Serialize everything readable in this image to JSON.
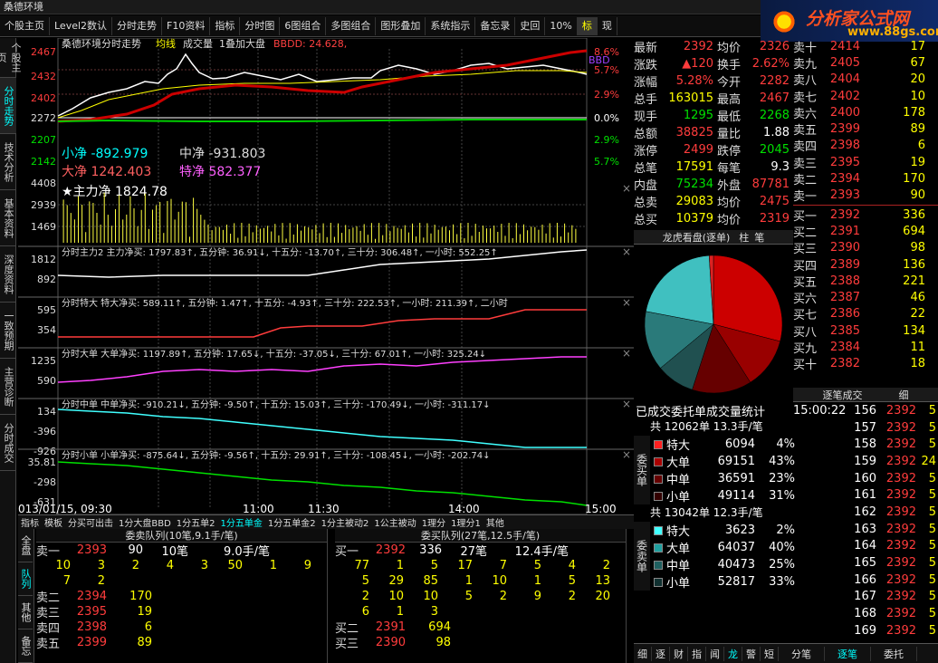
{
  "window": {
    "title": "桑德环境"
  },
  "toolbar": [
    "个股主页",
    "Level2数认",
    "分时走势",
    "F10资料",
    "指标",
    "分时图",
    "6图组合",
    "多图组合",
    "图形叠加",
    "系统指示",
    "备忘录",
    "史回",
    "10%",
    "标",
    "现"
  ],
  "logo": {
    "line1": "分析家公式网",
    "line2": "www.88gs.com"
  },
  "leftnav": [
    "个股主页",
    "分时走势",
    "技术分析",
    "基本资料",
    "深度资料",
    "一致预期",
    "主营诊断",
    "分时成交"
  ],
  "chart": {
    "header": {
      "name": "桑德环境分时走势",
      "avg": "均线",
      "vol": "成交量",
      "overlay": "1叠加大盘",
      "bbdd": "BBDD: 24.628,"
    },
    "price_labels": [
      "2467",
      "2432",
      "2402",
      "2272",
      "2207",
      "2142",
      "4408",
      "2939",
      "1469"
    ],
    "pct_labels": [
      "8.6%",
      "5.7%",
      "2.9%",
      "0.0%",
      "2.9%",
      "5.7%"
    ],
    "bbd_tag": "BBD",
    "net": {
      "small_label": "小净",
      "small": "-892.979",
      "mid_label": "中净",
      "mid": "-931.803",
      "big_label": "大净",
      "big": "1242.403",
      "super_label": "特净",
      "super": "582.377",
      "main_label": "★主力净",
      "main": "1824.78"
    },
    "sub": [
      {
        "labels": [
          "1812",
          "892"
        ],
        "hdr": "分时主力2 主力净买: 1797.83↑, 五分钟: 36.91↓, 十五分: -13.70↑, 三十分: 306.48↑, 一小时: 552.25↑"
      },
      {
        "labels": [
          "595",
          "354"
        ],
        "hdr": "分时特大 特大净买: 589.11↑, 五分钟: 1.47↑, 十五分: -4.93↑, 三十分: 222.53↑, 一小时: 211.39↑, 二小时"
      },
      {
        "labels": [
          "1235",
          "590"
        ],
        "hdr": "分时大单 大单净买: 1197.89↑, 五分钟: 17.65↓, 十五分: -37.05↓, 三十分: 67.01↑, 一小时: 325.24↓"
      },
      {
        "labels": [
          "134",
          "-396",
          "-926"
        ],
        "hdr": "分时中单 中单净买: -910.21↓, 五分钟: -9.50↑, 十五分: 15.03↑, 三十分: -170.49↓, 一小时: -311.17↓"
      },
      {
        "labels": [
          "35.81",
          "-298",
          "-631"
        ],
        "hdr": "分时小单 小单净买: -875.64↓, 五分钟: -9.56↑, 十五分: 29.91↑, 三十分: -108.45↓, 一小时: -202.74↓"
      }
    ],
    "xaxis": [
      "013/01/15, 09:30",
      "11:00",
      "11:30",
      "14:00",
      "15:00"
    ]
  },
  "quote": [
    [
      "最新",
      "2392",
      "均价",
      "2326"
    ],
    [
      "涨跌",
      "▲120",
      "换手",
      "2.62%"
    ],
    [
      "涨幅",
      "5.28%",
      "今开",
      "2282"
    ],
    [
      "总手",
      "163015",
      "最高",
      "2467"
    ],
    [
      "现手",
      "1295",
      "最低",
      "2268"
    ],
    [
      "总额",
      "38825",
      "量比",
      "1.88"
    ],
    [
      "涨停",
      "2499",
      "跌停",
      "2045"
    ],
    [
      "总笔",
      "17591",
      "每笔",
      "9.3"
    ],
    [
      "内盘",
      "75234",
      "外盘",
      "87781"
    ],
    [
      "总卖",
      "29083",
      "均价",
      "2475"
    ],
    [
      "总买",
      "10379",
      "均价",
      "2319"
    ]
  ],
  "pankou": {
    "sell": [
      [
        "卖十",
        "2414",
        "17"
      ],
      [
        "卖九",
        "2405",
        "67"
      ],
      [
        "卖八",
        "2404",
        "20"
      ],
      [
        "卖七",
        "2402",
        "10"
      ],
      [
        "卖六",
        "2400",
        "178"
      ],
      [
        "卖五",
        "2399",
        "89"
      ],
      [
        "卖四",
        "2398",
        "6"
      ],
      [
        "卖三",
        "2395",
        "19"
      ],
      [
        "卖二",
        "2394",
        "170"
      ],
      [
        "卖一",
        "2393",
        "90"
      ]
    ],
    "buy": [
      [
        "买一",
        "2392",
        "336"
      ],
      [
        "买二",
        "2391",
        "694"
      ],
      [
        "买三",
        "2390",
        "98"
      ],
      [
        "买四",
        "2389",
        "136"
      ],
      [
        "买五",
        "2388",
        "221"
      ],
      [
        "买六",
        "2387",
        "46"
      ],
      [
        "买七",
        "2386",
        "22"
      ],
      [
        "买八",
        "2385",
        "134"
      ],
      [
        "买九",
        "2384",
        "11"
      ],
      [
        "买十",
        "2382",
        "18"
      ]
    ]
  },
  "pie": {
    "title": "龙虎看盘(逐单)",
    "tabs": [
      "柱",
      "笔"
    ],
    "colors": [
      "#cc0000",
      "#990000",
      "#660000",
      "#205050",
      "#2a7a7a",
      "#40c0c0",
      "#dd2222"
    ],
    "values": [
      29,
      12,
      14,
      9,
      14,
      21,
      1
    ]
  },
  "stats": {
    "title": "已成交委托单成交量统计",
    "buy": {
      "summary": "共 12062单 13.3手/笔",
      "side": "委买单",
      "rows": [
        [
          "特大",
          "6094",
          "4%",
          "#ff2020"
        ],
        [
          "大单",
          "69151",
          "43%",
          "#aa0000"
        ],
        [
          "中单",
          "36591",
          "23%",
          "#660000"
        ],
        [
          "小单",
          "49114",
          "31%",
          "#330000"
        ]
      ]
    },
    "sell": {
      "summary": "共 13042单 12.3手/笔",
      "side": "委卖单",
      "rows": [
        [
          "特大",
          "3623",
          "2%",
          "#40ffff"
        ],
        [
          "大单",
          "64037",
          "40%",
          "#20a0a0"
        ],
        [
          "中单",
          "40473",
          "25%",
          "#206060"
        ],
        [
          "小单",
          "52817",
          "33%",
          "#103030"
        ]
      ]
    }
  },
  "ticks": {
    "title": "逐笔成交",
    "tag": "细",
    "rows": [
      [
        "15:00:22",
        "156",
        "2392",
        "5"
      ],
      [
        "",
        "157",
        "2392",
        "5"
      ],
      [
        "",
        "158",
        "2392",
        "5"
      ],
      [
        "",
        "159",
        "2392",
        "24"
      ],
      [
        "",
        "160",
        "2392",
        "5"
      ],
      [
        "",
        "161",
        "2392",
        "5"
      ],
      [
        "",
        "162",
        "2392",
        "5"
      ],
      [
        "",
        "163",
        "2392",
        "5"
      ],
      [
        "",
        "164",
        "2392",
        "5"
      ],
      [
        "",
        "165",
        "2392",
        "5"
      ],
      [
        "",
        "166",
        "2392",
        "5"
      ],
      [
        "",
        "167",
        "2392",
        "5"
      ],
      [
        "",
        "168",
        "2392",
        "5"
      ],
      [
        "",
        "169",
        "2392",
        "5"
      ]
    ]
  },
  "bottomtabs": [
    "指标",
    "模板",
    "分买可出击",
    "1分大盘BBD",
    "1分五单2",
    "1分五单金",
    "1分五单金2",
    "1分主被动2",
    "1公主被动",
    "1理分",
    "1理分1",
    "其他"
  ],
  "queue": {
    "sell_title": "委卖队列(10笔,9.1手/笔)",
    "buy_title": "委买队列(27笔,12.5手/笔)",
    "sell_head": [
      "卖一",
      "2393",
      "90",
      "10笔",
      "9.0手/笔"
    ],
    "buy_head": [
      "买一",
      "2392",
      "336",
      "27笔",
      "12.4手/笔"
    ],
    "sell_grid": [
      [
        "10",
        "3",
        "2",
        "4",
        "3",
        "50",
        "1",
        "9"
      ],
      [
        "7",
        "2"
      ]
    ],
    "buy_grid": [
      [
        "77",
        "1",
        "5",
        "17",
        "7",
        "5",
        "4",
        "2"
      ],
      [
        "5",
        "29",
        "85",
        "1",
        "10",
        "1",
        "5",
        "13"
      ],
      [
        "2",
        "10",
        "10",
        "5",
        "2",
        "9",
        "2",
        "20"
      ],
      [
        "6",
        "1",
        "3"
      ]
    ],
    "sell_rows": [
      [
        "卖二",
        "2394",
        "170"
      ],
      [
        "卖三",
        "2395",
        "19"
      ],
      [
        "卖四",
        "2398",
        "6"
      ],
      [
        "卖五",
        "2399",
        "89"
      ]
    ],
    "buy_rows": [
      [
        "买二",
        "2391",
        "694"
      ],
      [
        "买三",
        "2390",
        "98"
      ]
    ],
    "side_tabs": [
      "全盘",
      "队列",
      "其他",
      "备忘"
    ]
  },
  "righttabs": [
    "细",
    "逐",
    "财",
    "指",
    "闻",
    "龙",
    "警",
    "短",
    "分笔",
    "逐笔",
    "委托"
  ]
}
